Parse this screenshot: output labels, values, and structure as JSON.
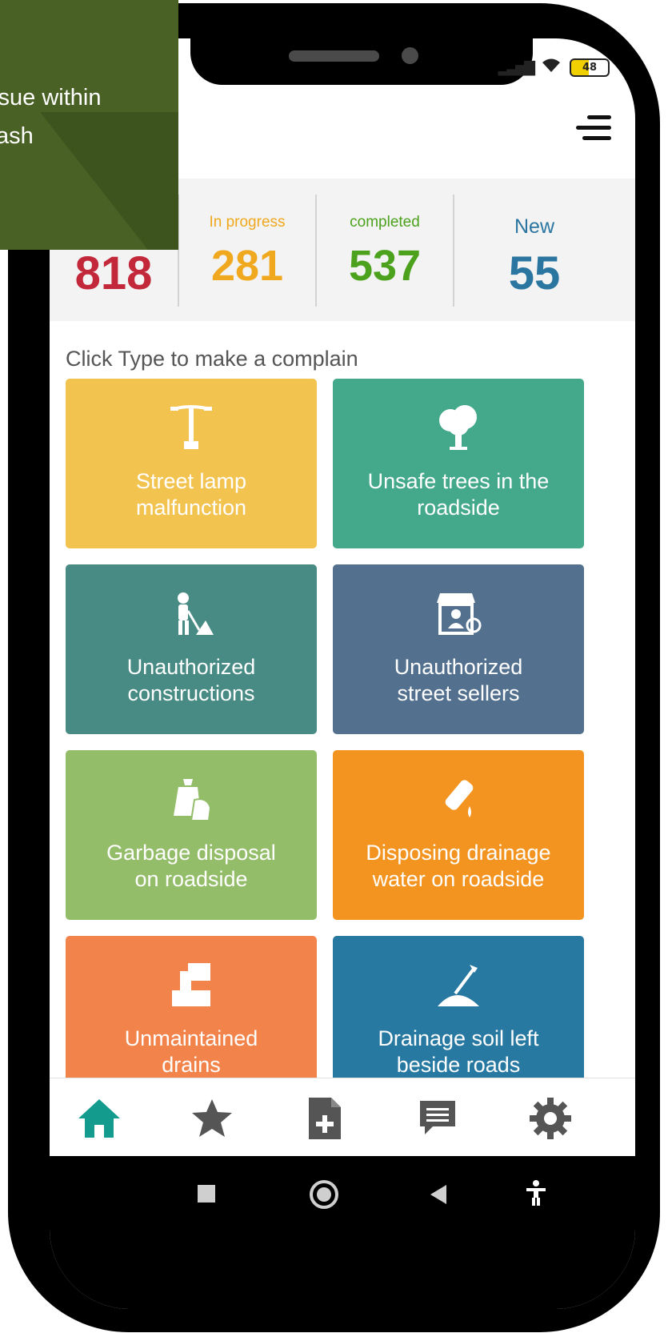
{
  "status_bar": {
    "battery": "48"
  },
  "stats": {
    "total": {
      "value": "818",
      "color": "#c3273a"
    },
    "in_progress": {
      "label": "In progress",
      "value": "281",
      "color": "#f0a81e"
    },
    "completed": {
      "label": "completed",
      "value": "537",
      "color": "#4ca21d"
    },
    "new": {
      "label": "New",
      "value": "55",
      "color": "#2b76a0"
    }
  },
  "instruction": "Click Type to make a complain",
  "tiles": [
    {
      "line1": "Street lamp",
      "line2": "malfunction",
      "color": "#f3c350",
      "icon": "street-lamp-icon"
    },
    {
      "line1": "Unsafe trees in the",
      "line2": "roadside",
      "color": "#44a98a",
      "icon": "tree-icon"
    },
    {
      "line1": "Unauthorized",
      "line2": "constructions",
      "color": "#478b84",
      "icon": "construction-worker-icon"
    },
    {
      "line1": "Unauthorized",
      "line2": "street sellers",
      "color": "#53708e",
      "icon": "street-vendor-icon"
    },
    {
      "line1": "Garbage disposal",
      "line2": "on roadside",
      "color": "#93bd69",
      "icon": "garbage-bags-icon"
    },
    {
      "line1": "Disposing drainage",
      "line2": "water on roadside",
      "color": "#f39420",
      "icon": "bottle-drip-icon"
    },
    {
      "line1": "Unmaintained",
      "line2": "drains",
      "color": "#f2834a",
      "icon": "drain-pipe-icon"
    },
    {
      "line1": "Drainage soil left",
      "line2": "beside roads",
      "color": "#2879a1",
      "icon": "shovel-soil-icon"
    }
  ],
  "bottom_nav": {
    "active_color": "#139b8d",
    "inactive_color": "#555555",
    "items": [
      "home-icon",
      "star-icon",
      "add-document-icon",
      "chat-icon",
      "settings-icon"
    ]
  },
  "overlay": {
    "line1": "ssue within",
    "line2": "ash",
    "color": "#4a6125"
  }
}
